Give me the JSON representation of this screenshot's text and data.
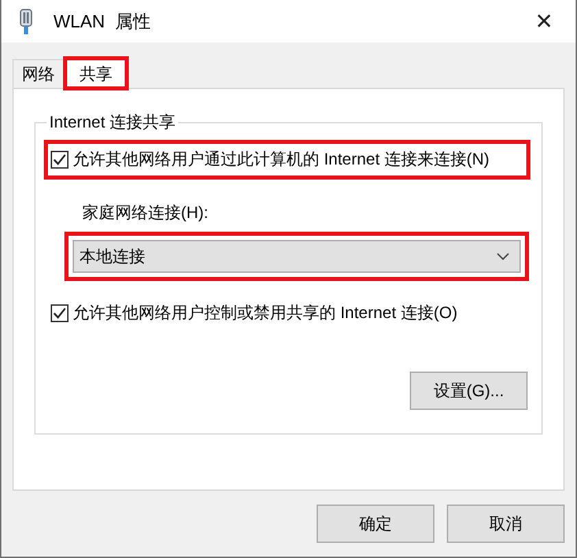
{
  "window": {
    "title": "WLAN  属性",
    "close": "✕"
  },
  "tabs": [
    {
      "label": "网络",
      "selected": false,
      "highlighted": false
    },
    {
      "label": "共享",
      "selected": true,
      "highlighted": true
    }
  ],
  "group": {
    "title": "Internet 连接共享",
    "allow_sharing": {
      "label": "允许其他网络用户通过此计算机的 Internet 连接来连接(N)",
      "checked": true,
      "highlighted": true
    },
    "home_network": {
      "label": "家庭网络连接(H):",
      "value": "本地连接",
      "highlighted": true
    },
    "allow_control": {
      "label": "允许其他网络用户控制或禁用共享的 Internet 连接(O)",
      "checked": true,
      "highlighted": false
    },
    "settings_button": "设置(G)..."
  },
  "buttons": [
    "确定",
    "取消"
  ]
}
